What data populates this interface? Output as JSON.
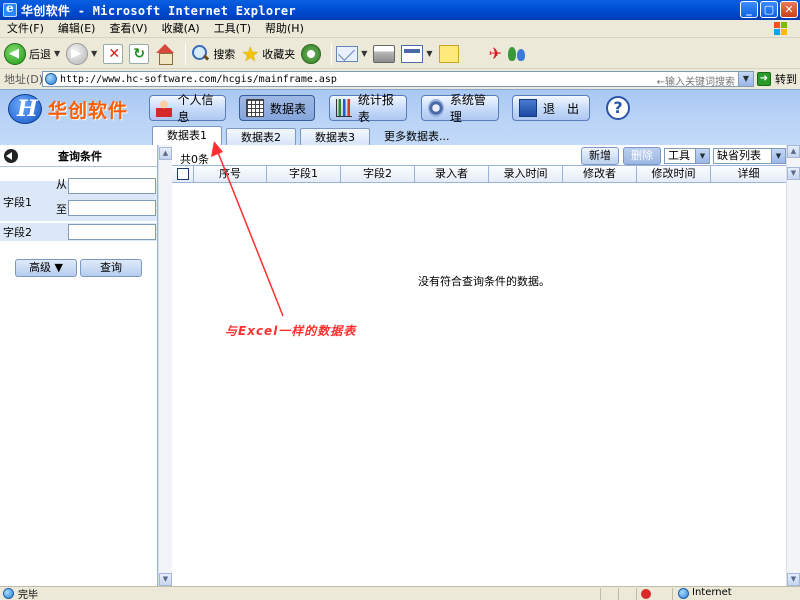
{
  "window": {
    "title": "华创软件 - Microsoft Internet Explorer"
  },
  "menubar": {
    "items": [
      "文件(F)",
      "编辑(E)",
      "查看(V)",
      "收藏(A)",
      "工具(T)",
      "帮助(H)"
    ]
  },
  "toolbar": {
    "back_label": "后退",
    "search_label": "搜索",
    "favorites_label": "收藏夹"
  },
  "address": {
    "label": "地址(D)",
    "url": "http://www.hc-software.com/hcgis/mainframe.asp",
    "search_hint": "←输入关键词搜索",
    "go_label": "转到"
  },
  "app": {
    "logo_text": "华创软件",
    "nav": [
      "个人信息",
      "数据表",
      "统计报表",
      "系统管理",
      "退　出"
    ],
    "help_label": "?",
    "tabs": [
      "数据表1",
      "数据表2",
      "数据表3",
      "更多数据表..."
    ]
  },
  "query_panel": {
    "title": "查询条件",
    "field1_label": "字段1",
    "from_label": "从",
    "to_label": "至",
    "field2_label": "字段2",
    "advanced_label": "高级 ▼",
    "search_label": "查询"
  },
  "grid": {
    "count_text": "共0条",
    "new_label": "新增",
    "delete_label": "删除",
    "tools_select": "工具",
    "view_select": "缺省列表",
    "columns": [
      "序号",
      "字段1",
      "字段2",
      "录入者",
      "录入时间",
      "修改者",
      "修改时间",
      "详细"
    ],
    "empty_message": "没有符合查询条件的数据。"
  },
  "annotation": {
    "text": "与Excel一样的数据表"
  },
  "statusbar": {
    "text": "完毕",
    "zone": "Internet"
  }
}
